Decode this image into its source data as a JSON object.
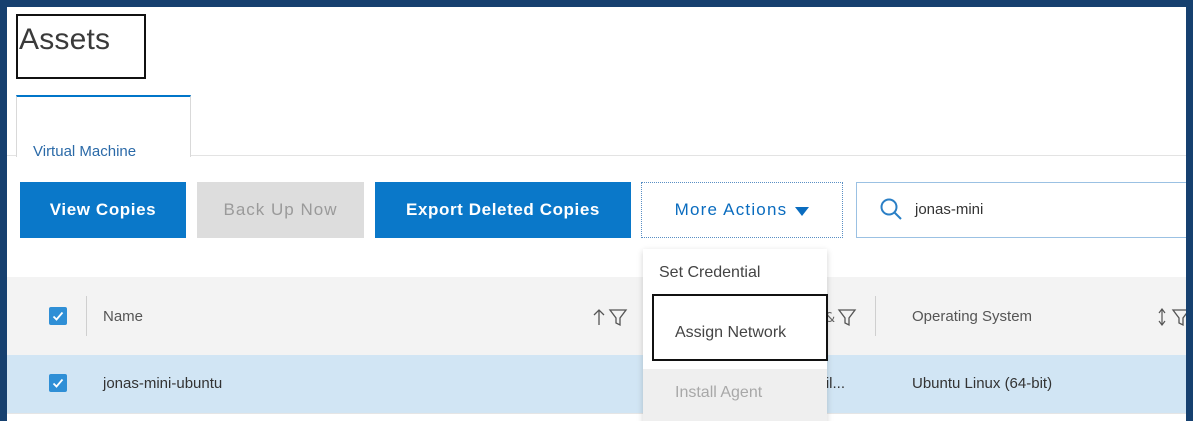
{
  "page": {
    "title": "Assets"
  },
  "tabs": [
    {
      "label": "Virtual Machine"
    }
  ],
  "toolbar": {
    "view_copies": "View Copies",
    "back_up_now": "Back Up Now",
    "export_deleted": "Export Deleted Copies",
    "more_actions": "More Actions"
  },
  "search": {
    "value": "jonas-mini"
  },
  "dropdown": {
    "items": [
      {
        "label": "Set Credential",
        "enabled": true
      },
      {
        "label": "Assign Network",
        "enabled": true,
        "highlighted": true
      },
      {
        "label": "Install Agent",
        "enabled": false
      }
    ]
  },
  "table": {
    "columns": [
      {
        "label": "Name",
        "sort": "asc"
      },
      {
        "label": "Operating System",
        "sort": "none"
      }
    ],
    "rows": [
      {
        "name": "jonas-mini-ubuntu",
        "hidden_col": "vail...",
        "os": "Ubuntu Linux (64-bit)",
        "selected": true
      }
    ]
  },
  "colors": {
    "primary": "#0a78c9",
    "frame": "#16406f",
    "selected_row": "#d1e5f4"
  }
}
